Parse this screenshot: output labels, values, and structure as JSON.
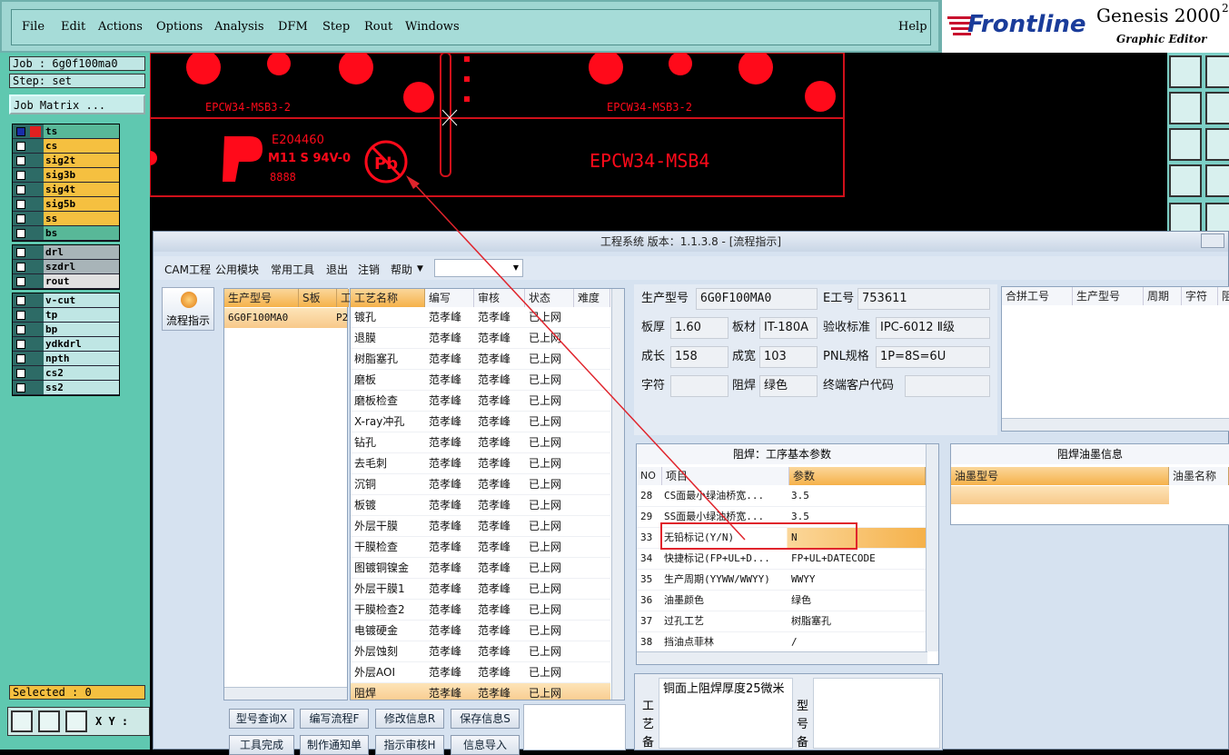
{
  "menu": {
    "items": [
      "File",
      "Edit",
      "Actions",
      "Options",
      "Analysis",
      "DFM",
      "Step",
      "Rout",
      "Windows"
    ],
    "help": "Help"
  },
  "logo": {
    "brand": "Frontline",
    "product": "Genesis 2000",
    "superscript": "2",
    "subtitle": "Graphic Editor"
  },
  "left": {
    "job": "Job : 6g0f100ma0",
    "step": "Step: set",
    "job_matrix": "Job Matrix ...",
    "selected": "Selected : 0",
    "xy_label": "X Y :",
    "layers_group1": [
      {
        "name": "ts",
        "color": "#58b898"
      },
      {
        "name": "cs",
        "color": "#f5c040"
      },
      {
        "name": "sig2t",
        "color": "#f5c040"
      },
      {
        "name": "sig3b",
        "color": "#f5c040"
      },
      {
        "name": "sig4t",
        "color": "#f5c040"
      },
      {
        "name": "sig5b",
        "color": "#f5c040"
      },
      {
        "name": "ss",
        "color": "#f5c040"
      },
      {
        "name": "bs",
        "color": "#58b898"
      }
    ],
    "layers_group2": [
      {
        "name": "drl",
        "color": "#a8b4b8"
      },
      {
        "name": "szdrl",
        "color": "#a8b4b8"
      },
      {
        "name": "rout",
        "color": "#e0e0e0"
      }
    ],
    "layers_group3": [
      {
        "name": "v-cut",
        "color": "#bfe6e4"
      },
      {
        "name": "tp",
        "color": "#bfe6e4"
      },
      {
        "name": "bp",
        "color": "#bfe6e4"
      },
      {
        "name": "ydkdrl",
        "color": "#bfe6e4"
      },
      {
        "name": "npth",
        "color": "#bfe6e4"
      },
      {
        "name": "cs2",
        "color": "#bfe6e4"
      },
      {
        "name": "ss2",
        "color": "#bfe6e4"
      }
    ]
  },
  "canvas": {
    "label_left": "EPCW34-MSB3-2",
    "label_right": "EPCW34-MSB3-2",
    "label_main": "EPCW34-MSB4",
    "ul_code": "E204460",
    "ul_line2": "M11 S 94V-0",
    "ul_line3": "8888",
    "pb_mark": "Pb"
  },
  "dialog": {
    "title": "工程系统   版本：1.1.3.8 - [流程指示]",
    "menu": [
      "CAM工程",
      "公用模块",
      "常用工具",
      "退出",
      "注销",
      "帮助"
    ],
    "sidebar_button": "流程指示",
    "model_table": {
      "headers": [
        "生产型号",
        "S板",
        "工"
      ],
      "rows": [
        [
          "6G0F100MA0",
          "P2"
        ]
      ]
    },
    "process_table": {
      "headers": [
        "工艺名称",
        "编写",
        "审核",
        "状态",
        "难度"
      ],
      "rows": [
        [
          "镀孔",
          "范孝峰",
          "范孝峰",
          "已上网"
        ],
        [
          "退膜",
          "范孝峰",
          "范孝峰",
          "已上网"
        ],
        [
          "树脂塞孔",
          "范孝峰",
          "范孝峰",
          "已上网"
        ],
        [
          "磨板",
          "范孝峰",
          "范孝峰",
          "已上网"
        ],
        [
          "磨板检查",
          "范孝峰",
          "范孝峰",
          "已上网"
        ],
        [
          "X-ray冲孔",
          "范孝峰",
          "范孝峰",
          "已上网"
        ],
        [
          "钻孔",
          "范孝峰",
          "范孝峰",
          "已上网"
        ],
        [
          "去毛刺",
          "范孝峰",
          "范孝峰",
          "已上网"
        ],
        [
          "沉铜",
          "范孝峰",
          "范孝峰",
          "已上网"
        ],
        [
          "板镀",
          "范孝峰",
          "范孝峰",
          "已上网"
        ],
        [
          "外层干膜",
          "范孝峰",
          "范孝峰",
          "已上网"
        ],
        [
          "干膜检查",
          "范孝峰",
          "范孝峰",
          "已上网"
        ],
        [
          "图镀铜镍金",
          "范孝峰",
          "范孝峰",
          "已上网"
        ],
        [
          "外层干膜1",
          "范孝峰",
          "范孝峰",
          "已上网"
        ],
        [
          "干膜检查2",
          "范孝峰",
          "范孝峰",
          "已上网"
        ],
        [
          "电镀硬金",
          "范孝峰",
          "范孝峰",
          "已上网"
        ],
        [
          "外层蚀刻",
          "范孝峰",
          "范孝峰",
          "已上网"
        ],
        [
          "外层AOI",
          "范孝峰",
          "范孝峰",
          "已上网"
        ],
        [
          "阻焊",
          "范孝峰",
          "范孝峰",
          "已上网"
        ]
      ]
    },
    "buttons_row1": [
      "型号查询X",
      "编写流程F",
      "修改信息R",
      "保存信息S"
    ],
    "buttons_row2": [
      "工具完成",
      "制作通知单",
      "指示审核H",
      "信息导入"
    ],
    "info": {
      "model_label": "生产型号",
      "model": "6G0F100MA0",
      "eno_label": "E工号",
      "eno": "753611",
      "thick_label": "板厚",
      "thick": "1.60",
      "mat_label": "板材",
      "mat": "IT-180A",
      "std_label": "验收标准",
      "std": "IPC-6012 Ⅱ级",
      "len_label": "成长",
      "len": "158",
      "wid_label": "成宽",
      "wid": "103",
      "pnl_label": "PNL规格",
      "pnl": "1P=8S=6U",
      "legend_label": "字符",
      "legend": "",
      "mask_label": "阻焊",
      "mask": "绿色",
      "cust_label": "终端客户代码",
      "cust": ""
    },
    "merge_table": {
      "headers": [
        "合拼工号",
        "生产型号",
        "周期",
        "字符",
        "阻"
      ]
    },
    "params": {
      "title": "阻焊：工序基本参数",
      "headers": [
        "NO",
        "项目",
        "参数"
      ],
      "rows": [
        [
          "28",
          "CS面最小绿油桥宽...",
          "3.5"
        ],
        [
          "29",
          "SS面最小绿油桥宽...",
          "3.5"
        ],
        [
          "33",
          "无铅标记(Y/N)",
          "N"
        ],
        [
          "34",
          "快捷标记(FP+UL+D...",
          "FP+UL+DATECODE"
        ],
        [
          "35",
          "生产周期(YYWW/WWYY)",
          "WWYY"
        ],
        [
          "36",
          "油墨颜色",
          "绿色"
        ],
        [
          "37",
          "过孔工艺",
          "树脂塞孔"
        ],
        [
          "38",
          "挡油点菲林",
          "/"
        ]
      ]
    },
    "ink": {
      "title": "阻焊油墨信息",
      "headers": [
        "油墨型号",
        "油墨名称"
      ]
    },
    "notes": {
      "side1": "工艺备",
      "text": "铜面上阻焊厚度25微米",
      "side2": "型号备"
    }
  }
}
